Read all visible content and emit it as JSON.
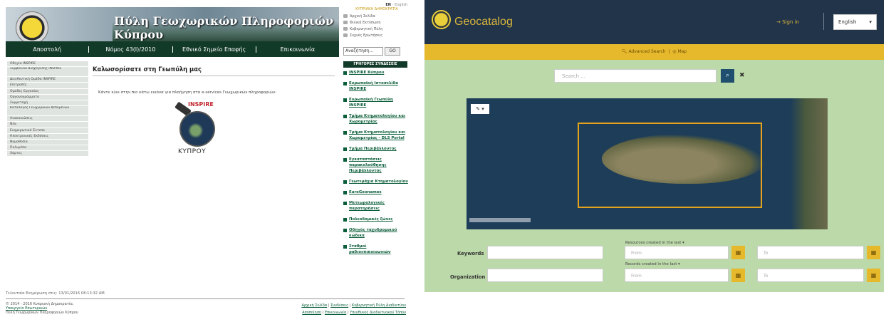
{
  "left": {
    "banner_title": "Πύλη Γεωχωρικών Πληροφοριών Κύπρου",
    "nav": [
      "Αποστολή",
      "Νόμος 43(Ι)/2010",
      "Εθνικό Σημείο Επαφής",
      "Επικοινωνία"
    ],
    "lang": {
      "active": "EN",
      "sep": " - ",
      "other": "English"
    },
    "republic": "ΚΥΠΡΙΑΚΗ  ΔΗΜΟΚΡΑΤΙΑ",
    "top_links": [
      "Αρχική Σελίδα",
      "Φιλική Εκτύπωση",
      "Κυβερνητική Πύλη",
      "Συχνές Ερωτήσεις"
    ],
    "search": {
      "value": "Αναζήτηση...",
      "button": "GO"
    },
    "quick_links_header": "ΓΡΗΓΟΡΕΣ ΣΥΝΔΕΣΕΙΣ",
    "quick_links": [
      "INSPIRE Κύπρου",
      "Ευρωπαϊκή Ιστοσελίδα INSPIRE",
      "Ευρωπαϊκή Γεωπύλη INSPIRE",
      "Τμήμα Κτηματολογίου και Χωρομετρίας",
      "Τμήμα Κτηματολογίου και Χωρομετρίας - DLS Portal",
      "Τμήμα Περιβάλλοντος",
      "Εγκαταστάσεις παρακολούθησης Περιβάλλοντος",
      "Γεωτεμάχια Κτηματολογίου",
      "EuroGeonames",
      "Μετεωρολογικές παρατηρήσεις",
      "Πολεοδομικές ζώνες",
      "Οδηγός ταχυδρομικού κώδικα",
      "Σταθμοί ραδιοεπικοινωνιών"
    ],
    "sidebar": [
      "Οδηγία INSPIRE",
      "Συμβούλιο Διαχείρισης INSPIRE",
      "Διευθυντική Ομάδα INSPIRE",
      "Επιτροπές",
      "Ομάδες Εργασίας",
      "Οργανογράμματα",
      "Συμμετοχή",
      "Κατάλογος Γεωχωρικών Δεδομένων",
      "Ανακοινώσεις",
      "Νέα",
      "Ενημερωτικό Έντυπο",
      "Ηλεκτρονικές Εκδόσεις",
      "Νομοθεσία",
      "Πολυμέσα",
      "Χάρτες"
    ],
    "welcome": "Καλωσορίσατε στη Γεωπύλη μας",
    "intro": "Κάντε κλικ στην πιο κάτω εικόνα για πλοήγηση στα e-services Γεωχωρικών πληροφοριών:",
    "inspire_word": "INSPIRE",
    "cyprus_word": "ΚΥΠΡΟΥ",
    "updated": "Τελευταία Ενημέρωση στις: 13/01/2016 08:13:32 AM",
    "footer_left": [
      "© 2014 - 2016 Κυπριακή Δημοκρατία,",
      "Υπουργείο Εσωτερικών",
      "Πύλη Γεωχωρικών Πληροφοριών Κύπρου"
    ],
    "footer_right_1": [
      "Αρχική Σελίδα",
      "Συνδέσεις",
      "Κυβερνητική Πύλη Διαδικτύου"
    ],
    "footer_right_2": [
      "Αποποίηση",
      "Επικοινωνία",
      "Υπεύθυνος Διαδικτυακού Τόπου"
    ]
  },
  "right": {
    "brand": "Geocatalog",
    "signin": "Sign in",
    "language": "English",
    "bar": {
      "advanced": "Advanced Search",
      "map": "Map"
    },
    "search_placeholder": "Search ...",
    "resources_caption": "Resources created in the last",
    "records_caption": "Records created in the last",
    "keyword_label": "Keywords",
    "organization_label": "Organization",
    "from": "From",
    "to": "To",
    "colors": {
      "accent": "#e6b82b",
      "topbar": "#22344a",
      "map_box": "#e2a21d"
    }
  }
}
